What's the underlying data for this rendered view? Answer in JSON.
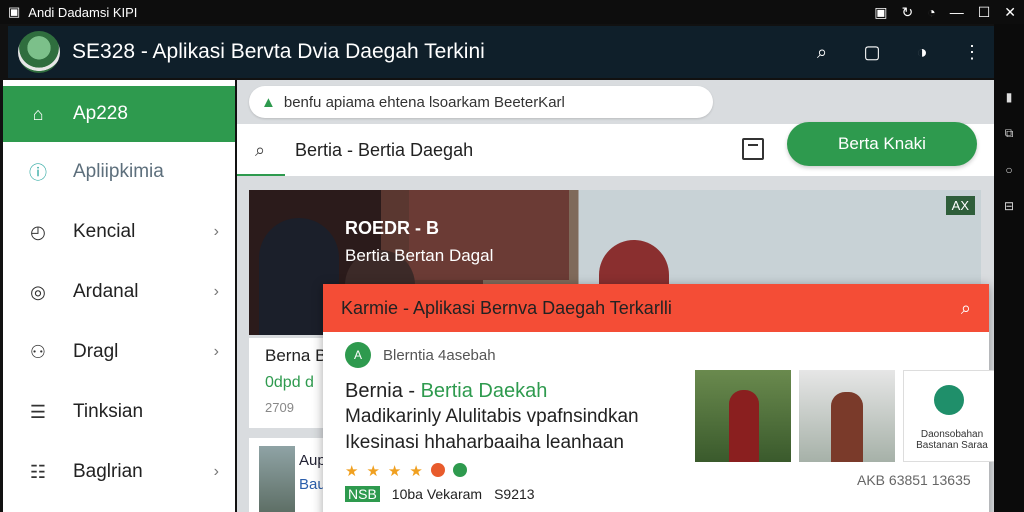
{
  "statusbar": {
    "title": "Andi Dadamsi KIPI"
  },
  "appbar": {
    "title": "SE328 - Aplikasi Bervta Dvia Daegah Terkini"
  },
  "sidebar": {
    "items": [
      {
        "label": "Ap228",
        "icon": "home-icon",
        "active": true
      },
      {
        "label": "Apliipkimia",
        "icon": "info-icon"
      },
      {
        "label": "Kencial",
        "icon": "clock-icon"
      },
      {
        "label": "Ardanal",
        "icon": "gauge-icon"
      },
      {
        "label": "Dragl",
        "icon": "user-icon"
      },
      {
        "label": "Tinksian",
        "icon": "document-icon"
      },
      {
        "label": "Baglrian",
        "icon": "list-icon"
      }
    ]
  },
  "content": {
    "url": "benfu apiama ehtena lsoarkam BeeterKarl",
    "search_value": "Bertia - Bertia Daegah",
    "cta_label": "Berta Knaki",
    "hero": {
      "kicker": "ROEDR - B",
      "title": "Bertia Bertan Dagal",
      "tag": "AX"
    },
    "list": [
      {
        "title": "Berna B",
        "subtitle": "0dpd d",
        "meta": "2709"
      },
      {
        "title": "Aup",
        "subtitle": "Bau"
      }
    ],
    "popup": {
      "header": "Karmie - Aplikasi Bernva Daegah Terkarlli",
      "source": "Blerntia 4asebah",
      "headline_prefix": "Bernia - ",
      "headline_highlight": "Bertia Daekah",
      "description": "Madikarinly Alulitabis vpafnsindkan Ikesinasi hhaharbaaiha leanhaan",
      "meta_label": "NSB",
      "meta_count": "10ba Vekaram",
      "meta_extra": "S9213",
      "thumb_text": "Daonsobahan Bastanan Saraa",
      "thumbs_caption": "AKB 63851 13635"
    }
  },
  "colors": {
    "accent": "#2e9a4e",
    "popup_header": "#f44d36",
    "appbar": "#0f1f2a"
  }
}
